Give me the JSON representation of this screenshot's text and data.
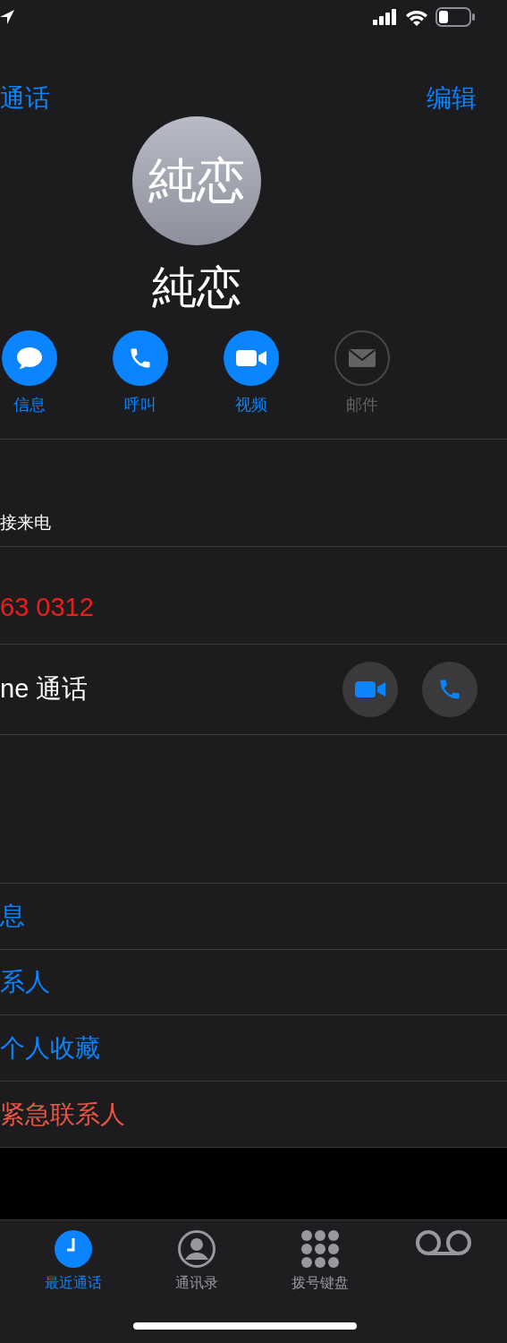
{
  "nav": {
    "back": "通话",
    "edit": "编辑"
  },
  "contact": {
    "avatar_text": "純恋",
    "name": "純恋"
  },
  "actions": [
    {
      "kind": "message",
      "label": "信息",
      "disabled": false
    },
    {
      "kind": "call",
      "label": "呼叫",
      "disabled": false
    },
    {
      "kind": "video",
      "label": "视频",
      "disabled": false
    },
    {
      "kind": "mail",
      "label": "邮件",
      "disabled": true
    }
  ],
  "call_section": {
    "header": "接来电",
    "number": "63 0312",
    "facetime": "ne 通话"
  },
  "links": [
    {
      "label": "息",
      "destructive": false
    },
    {
      "label": "系人",
      "destructive": false
    },
    {
      "label": "个人收藏",
      "destructive": false
    },
    {
      "label": "紧急联系人",
      "destructive": true
    }
  ],
  "tabs": [
    {
      "kind": "recents",
      "label": "最近通话",
      "selected": true
    },
    {
      "kind": "contacts",
      "label": "通讯录",
      "selected": false
    },
    {
      "kind": "keypad",
      "label": "拨号键盘",
      "selected": false
    },
    {
      "kind": "voicemail",
      "selected": false
    }
  ]
}
